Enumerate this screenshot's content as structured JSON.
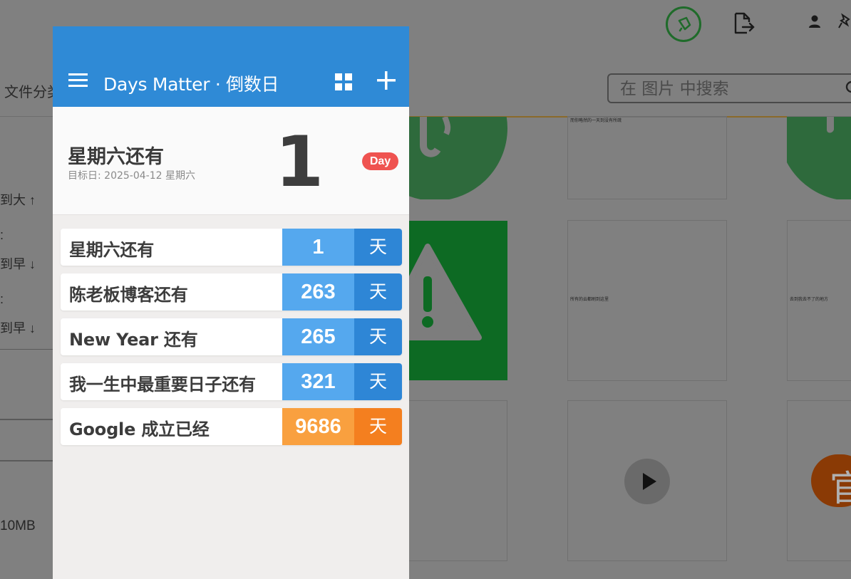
{
  "background": {
    "classify_label": "文件分类",
    "search_placeholder": "在 图片 中搜索",
    "sort_items": [
      "到大 ↑",
      "到早 ↓",
      "到早 ↓"
    ],
    "sort_heads": [
      ":",
      ":"
    ],
    "size_label": "10MB",
    "thumb_captions": [
      "而你略然的一天到没有所疏",
      "所有的云都刷到这里",
      "去到我去不了的地方"
    ],
    "tile_glyph": "官"
  },
  "app": {
    "title": "Days Matter · 倒数日",
    "header_color": "#2f8ad6",
    "hero": {
      "title": "星期六还有",
      "target_date": "目标日: 2025-04-12 星期六",
      "days": "1",
      "badge": "Day"
    },
    "events": [
      {
        "label": "星期六还有",
        "days": "1",
        "unit": "天",
        "count_color": "#55a8ee",
        "unit_color": "#2e86d6"
      },
      {
        "label": "陈老板博客还有",
        "days": "263",
        "unit": "天",
        "count_color": "#55a8ee",
        "unit_color": "#2e86d6"
      },
      {
        "label": "New Year 还有",
        "days": "265",
        "unit": "天",
        "count_color": "#55a8ee",
        "unit_color": "#2e86d6"
      },
      {
        "label": "我一生中最重要日子还有",
        "days": "321",
        "unit": "天",
        "count_color": "#55a8ee",
        "unit_color": "#2e86d6"
      },
      {
        "label": "Google 成立已经",
        "days": "9686",
        "unit": "天",
        "count_color": "#f9a03f",
        "unit_color": "#f47f1f"
      }
    ]
  }
}
